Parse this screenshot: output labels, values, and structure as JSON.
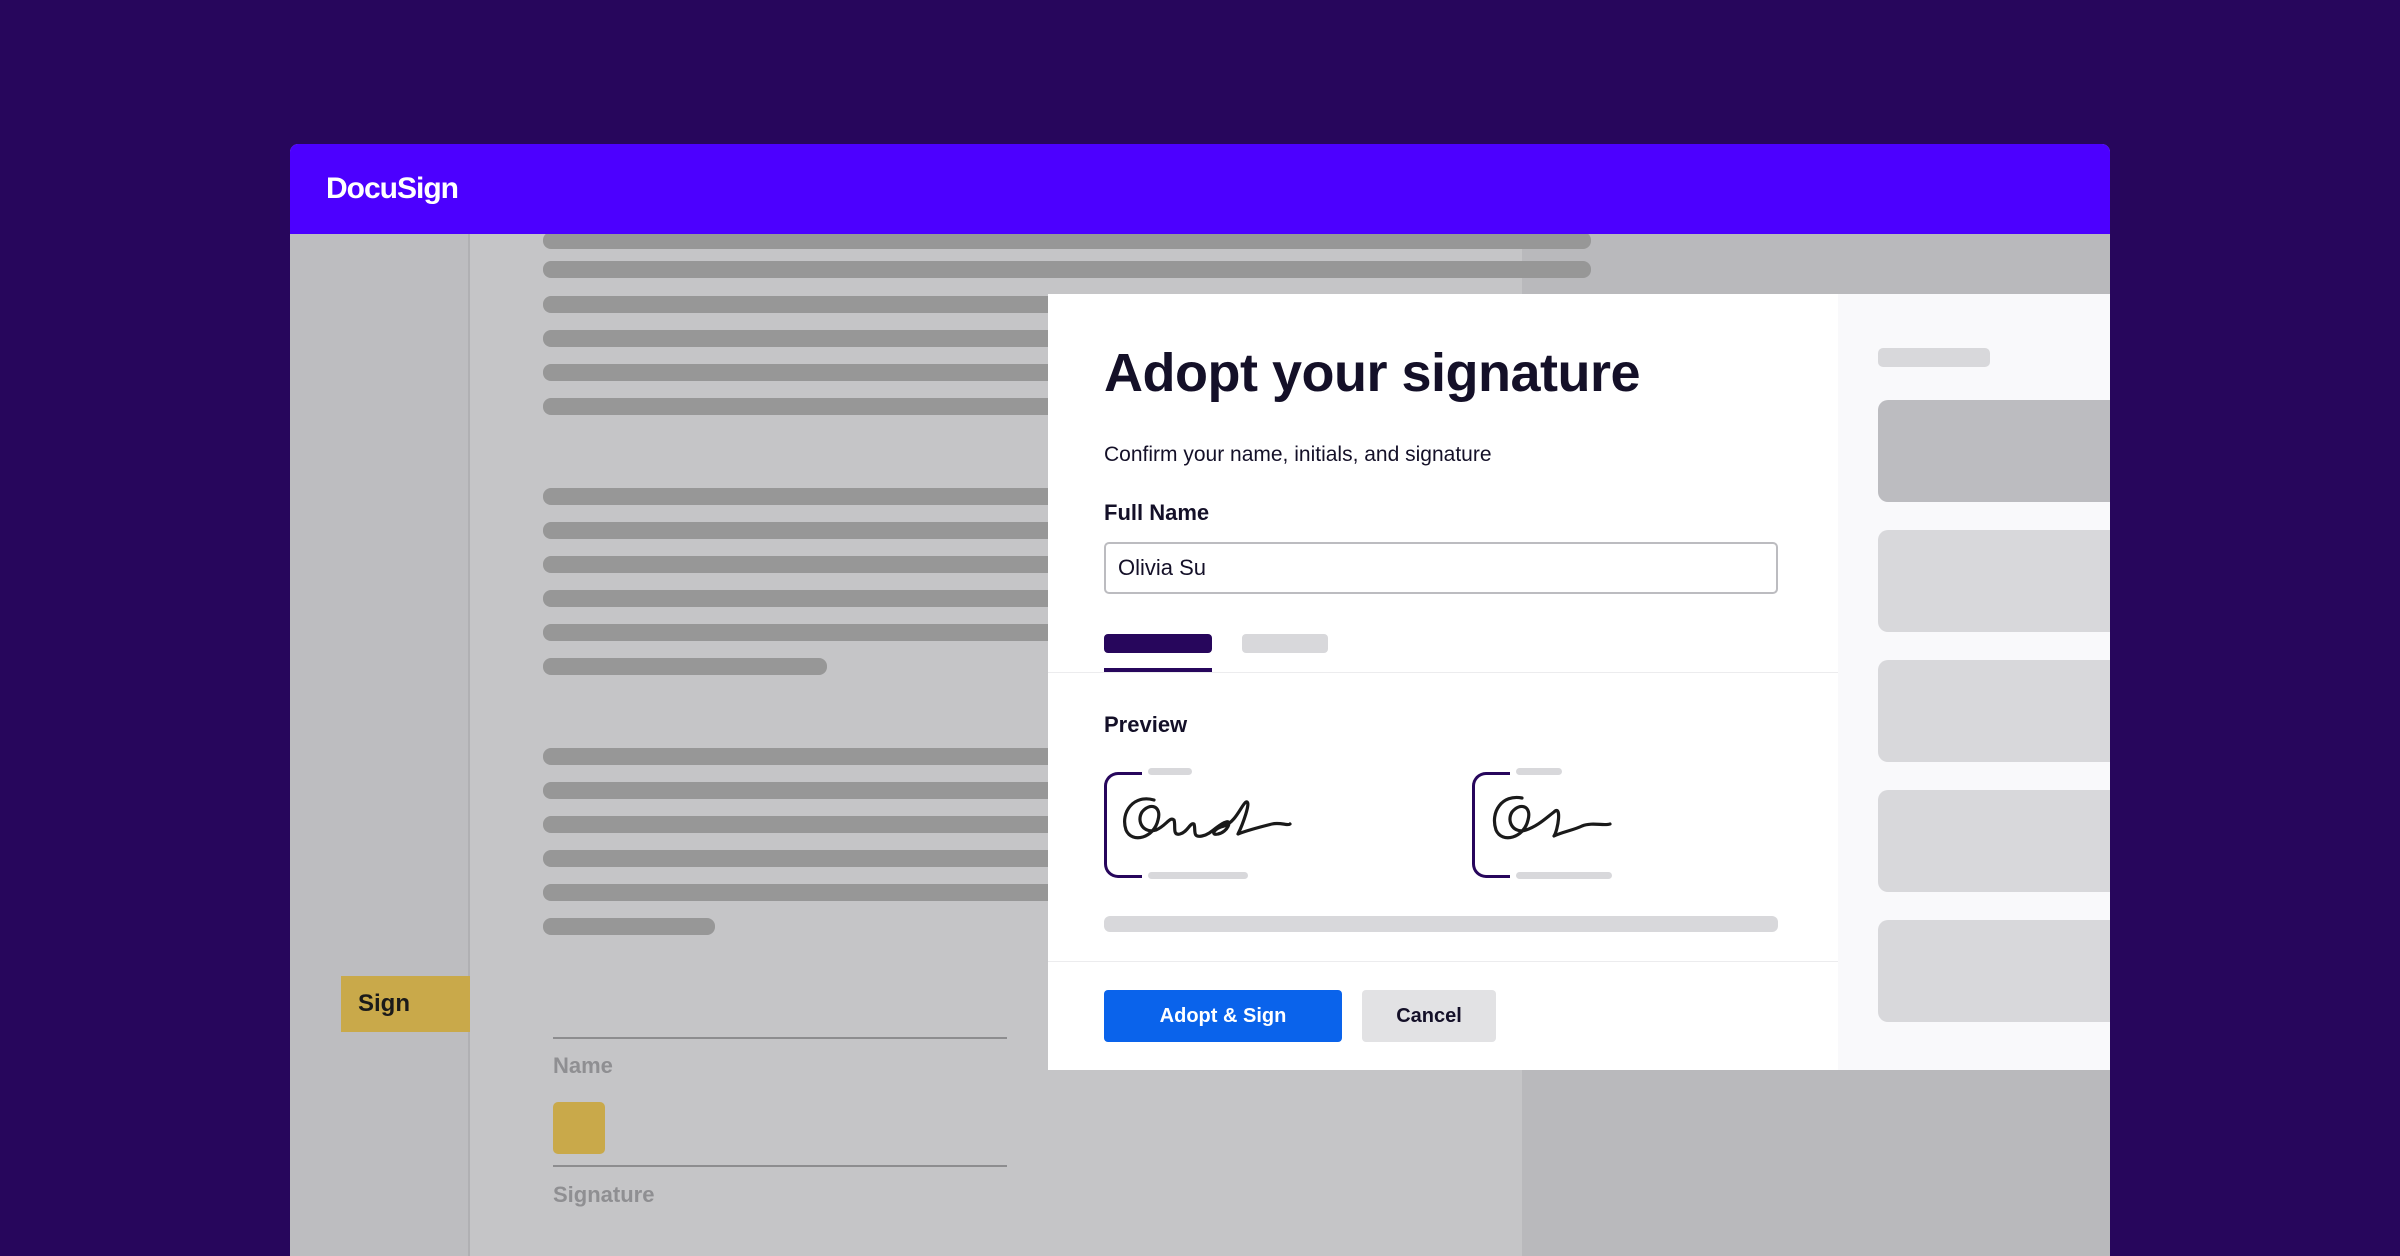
{
  "brand": {
    "logo_text": "DocuSign",
    "header_color": "#4c00ff",
    "background_color": "#27065c"
  },
  "document": {
    "sign_tab_label": "Sign",
    "name_field_label": "Name",
    "signature_field_label": "Signature",
    "tag_color": "#c9a94a"
  },
  "modal": {
    "title": "Adopt your signature",
    "subtitle": "Confirm your name, initials, and signature",
    "full_name_label": "Full Name",
    "full_name_value": "Olivia Su",
    "preview_label": "Preview",
    "adopt_button_label": "Adopt & Sign",
    "cancel_button_label": "Cancel",
    "accent_color": "#27065c",
    "primary_button_color": "#0a63eb"
  }
}
